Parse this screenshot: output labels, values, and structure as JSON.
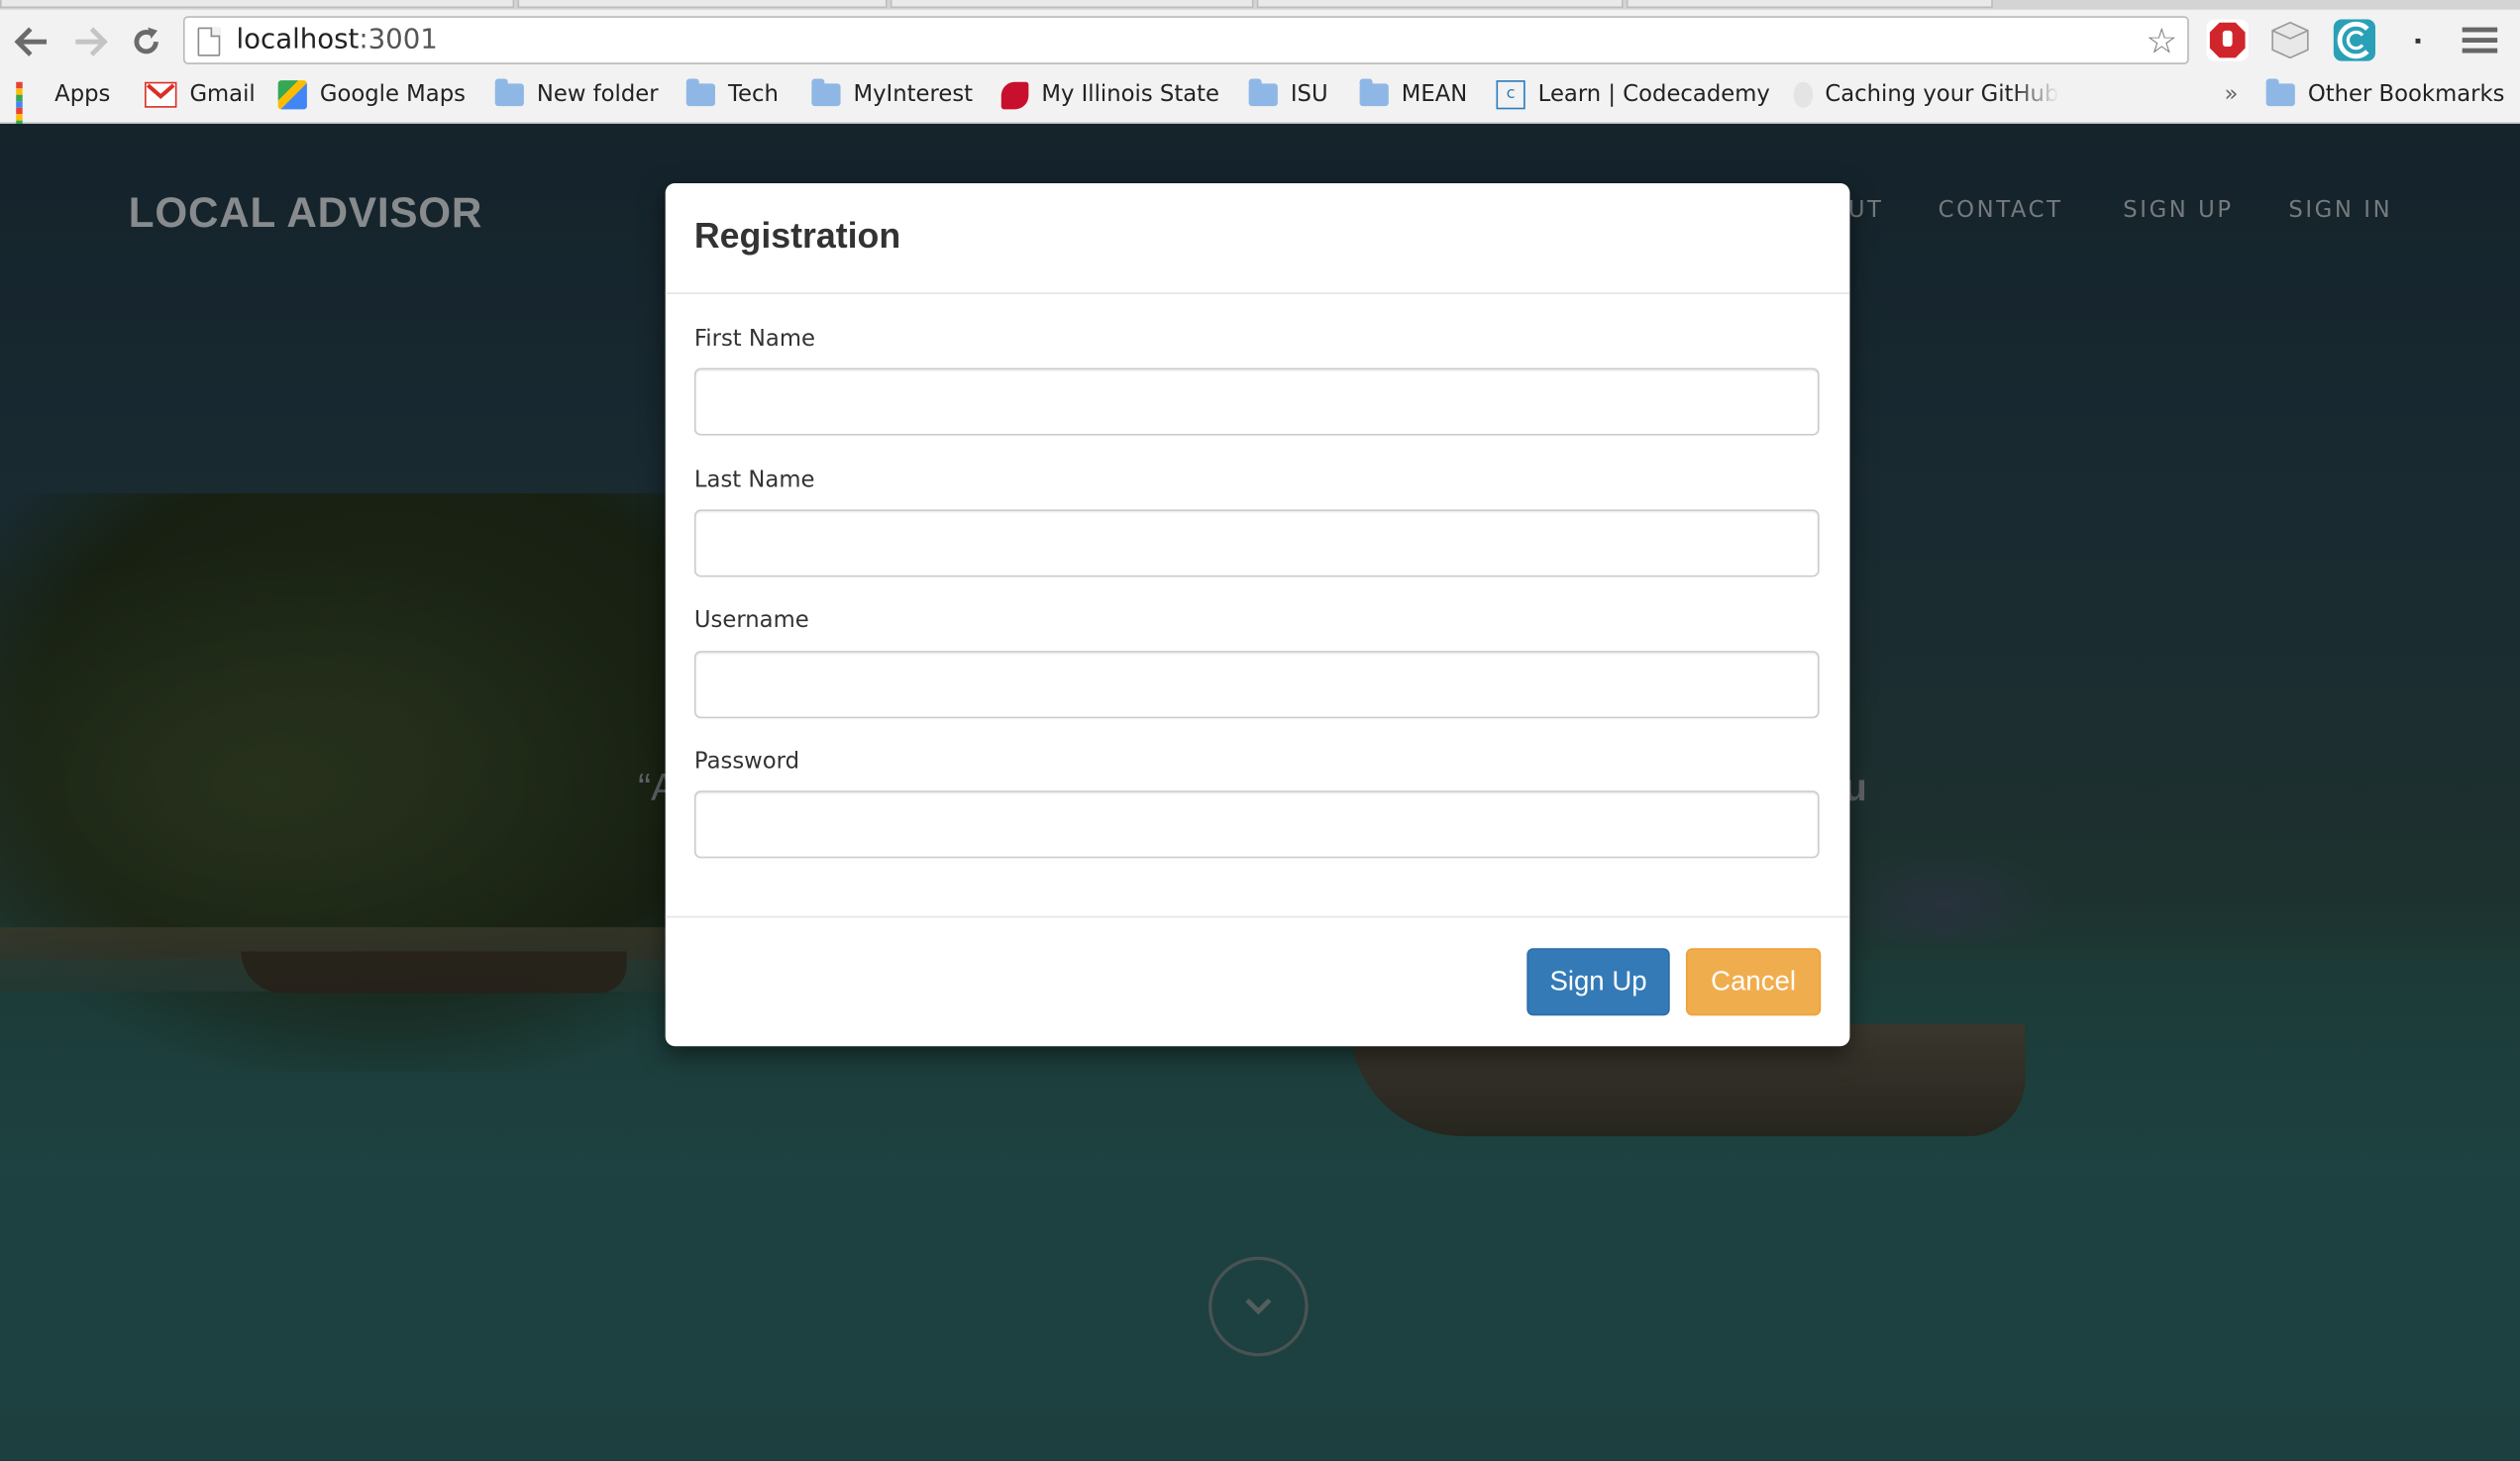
{
  "browser": {
    "url_host": "localhost",
    "url_port": ":3001",
    "bookmarks": [
      {
        "label": "Apps",
        "icon": "apps-grid-icon"
      },
      {
        "label": "Gmail",
        "icon": "gmail-icon"
      },
      {
        "label": "Google Maps",
        "icon": "google-maps-icon"
      },
      {
        "label": "New folder",
        "icon": "folder-icon"
      },
      {
        "label": "Tech",
        "icon": "folder-icon"
      },
      {
        "label": "MyInterest",
        "icon": "folder-icon"
      },
      {
        "label": "My Illinois State",
        "icon": "redbird-icon"
      },
      {
        "label": "ISU",
        "icon": "folder-icon"
      },
      {
        "label": "MEAN",
        "icon": "folder-icon"
      },
      {
        "label": "Learn | Codecademy",
        "icon": "codecademy-icon"
      },
      {
        "label": "Caching your GitHub",
        "icon": "github-icon"
      }
    ],
    "overflow_label": "»",
    "other_bookmarks": "Other Bookmarks"
  },
  "site": {
    "brand": "LOCAL ADVISOR",
    "nav": {
      "about_partial": "UT",
      "contact": "CONTACT",
      "signup": "SIGN UP",
      "signin": "SIGN IN"
    },
    "hero_quote_start": "“A",
    "hero_quote_end": "u"
  },
  "modal": {
    "title": "Registration",
    "fields": [
      {
        "label": "First Name",
        "value": ""
      },
      {
        "label": "Last Name",
        "value": ""
      },
      {
        "label": "Username",
        "value": ""
      },
      {
        "label": "Password",
        "value": ""
      }
    ],
    "signup_button": "Sign Up",
    "cancel_button": "Cancel"
  },
  "colors": {
    "primary": "#337ab7",
    "warning": "#f0ad4e"
  }
}
